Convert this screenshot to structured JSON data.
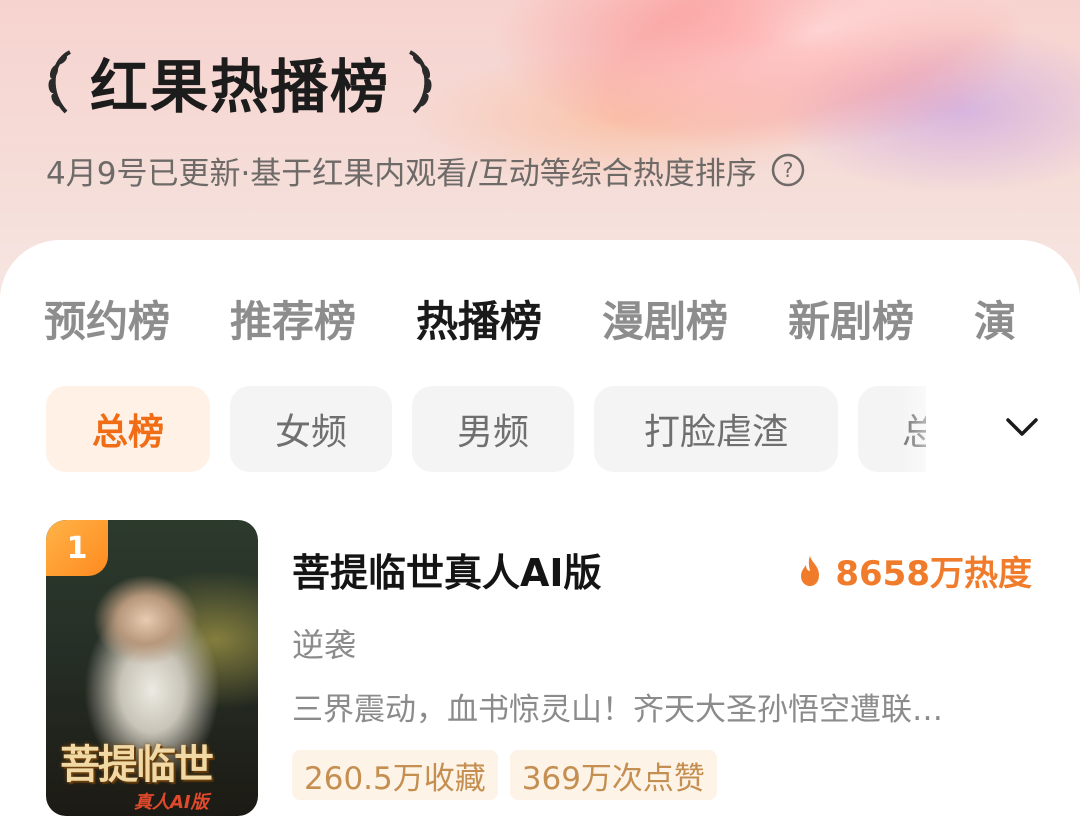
{
  "header": {
    "title": "红果热播榜",
    "subtitle": "4月9号已更新·基于红果内观看/互动等综合热度排序"
  },
  "tabs": [
    {
      "label": "预约榜",
      "active": false
    },
    {
      "label": "推荐榜",
      "active": false
    },
    {
      "label": "热播榜",
      "active": true
    },
    {
      "label": "漫剧榜",
      "active": false
    },
    {
      "label": "新剧榜",
      "active": false
    },
    {
      "label": "演",
      "active": false
    }
  ],
  "chips": [
    {
      "label": "总榜",
      "active": true
    },
    {
      "label": "女频",
      "active": false
    },
    {
      "label": "男频",
      "active": false
    },
    {
      "label": "打脸虐渣",
      "active": false
    },
    {
      "label": "总",
      "active": false
    }
  ],
  "items": [
    {
      "rank": "1",
      "title": "菩提临世真人AI版",
      "heat": "8658万热度",
      "genre": "逆袭",
      "description": "三界震动，血书惊灵山！齐天大圣孙悟空遭联…",
      "favorites": "260.5万收藏",
      "likes": "369万次点赞",
      "cover_title": "菩提临世",
      "cover_subtitle": "真人AI版"
    }
  ],
  "colors": {
    "accent": "#f06d16",
    "heat": "#f07b2a",
    "stat_text": "#c58f52",
    "rank_badge": "#ff9a2e"
  },
  "icons": {
    "help": "question-circle-icon",
    "expand": "chevron-down-icon",
    "heat": "fire-icon",
    "laurel": "laurel-icon"
  }
}
